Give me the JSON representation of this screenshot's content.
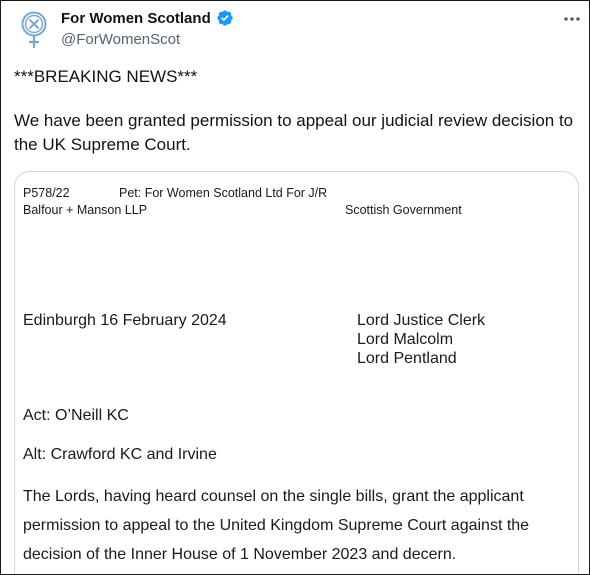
{
  "author": {
    "name": "For Women Scotland",
    "handle": "@ForWomenScot",
    "avatar_icon": "venus-crest-icon",
    "verified_icon": "verified-badge-icon",
    "verified_color": "#1d9bf0"
  },
  "menu_icon": "more-options-icon",
  "tweet": {
    "line1": "***BREAKING NEWS***",
    "line2": "We have been granted permission to appeal our judicial review decision to the UK Supreme Court."
  },
  "document": {
    "case_no": "P578/22",
    "petition": "Pet: For Women Scotland Ltd For J/R",
    "agent_left": "Balfour + Manson LLP",
    "agent_right": "Scottish Government",
    "place_date": "Edinburgh 16 February 2024",
    "judges": [
      "Lord Justice Clerk",
      "Lord Malcolm",
      "Lord Pentland"
    ],
    "act": "Act: O’Neill KC",
    "alt": "Alt: Crawford KC and Irvine",
    "interlocutor": "The Lords, having heard counsel on the single bills, grant the applicant permission to appeal to the United Kingdom Supreme Court against the decision of the Inner House of 1 November 2023 and decern."
  }
}
